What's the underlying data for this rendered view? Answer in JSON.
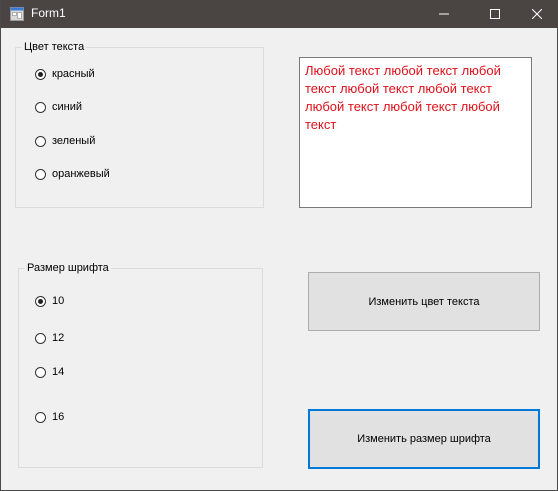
{
  "window": {
    "title": "Form1"
  },
  "color_group": {
    "title": "Цвет текста",
    "options": [
      {
        "label": "красный",
        "checked": true
      },
      {
        "label": "синий",
        "checked": false
      },
      {
        "label": "зеленый",
        "checked": false
      },
      {
        "label": "оранжевый",
        "checked": false
      }
    ]
  },
  "size_group": {
    "title": "Размер шрифта",
    "options": [
      {
        "label": "10",
        "checked": true
      },
      {
        "label": "12",
        "checked": false
      },
      {
        "label": "14",
        "checked": false
      },
      {
        "label": "16",
        "checked": false
      }
    ]
  },
  "textbox": {
    "text": "Любой текст любой текст любой текст любой текст любой текст любой текст любой текст любой текст",
    "color": "#e0101a"
  },
  "buttons": {
    "change_color": "Изменить цвет текста",
    "change_size": "Изменить размер шрифта"
  },
  "colors": {
    "accent": "#0078d7",
    "titlebar": "#4a4542"
  }
}
